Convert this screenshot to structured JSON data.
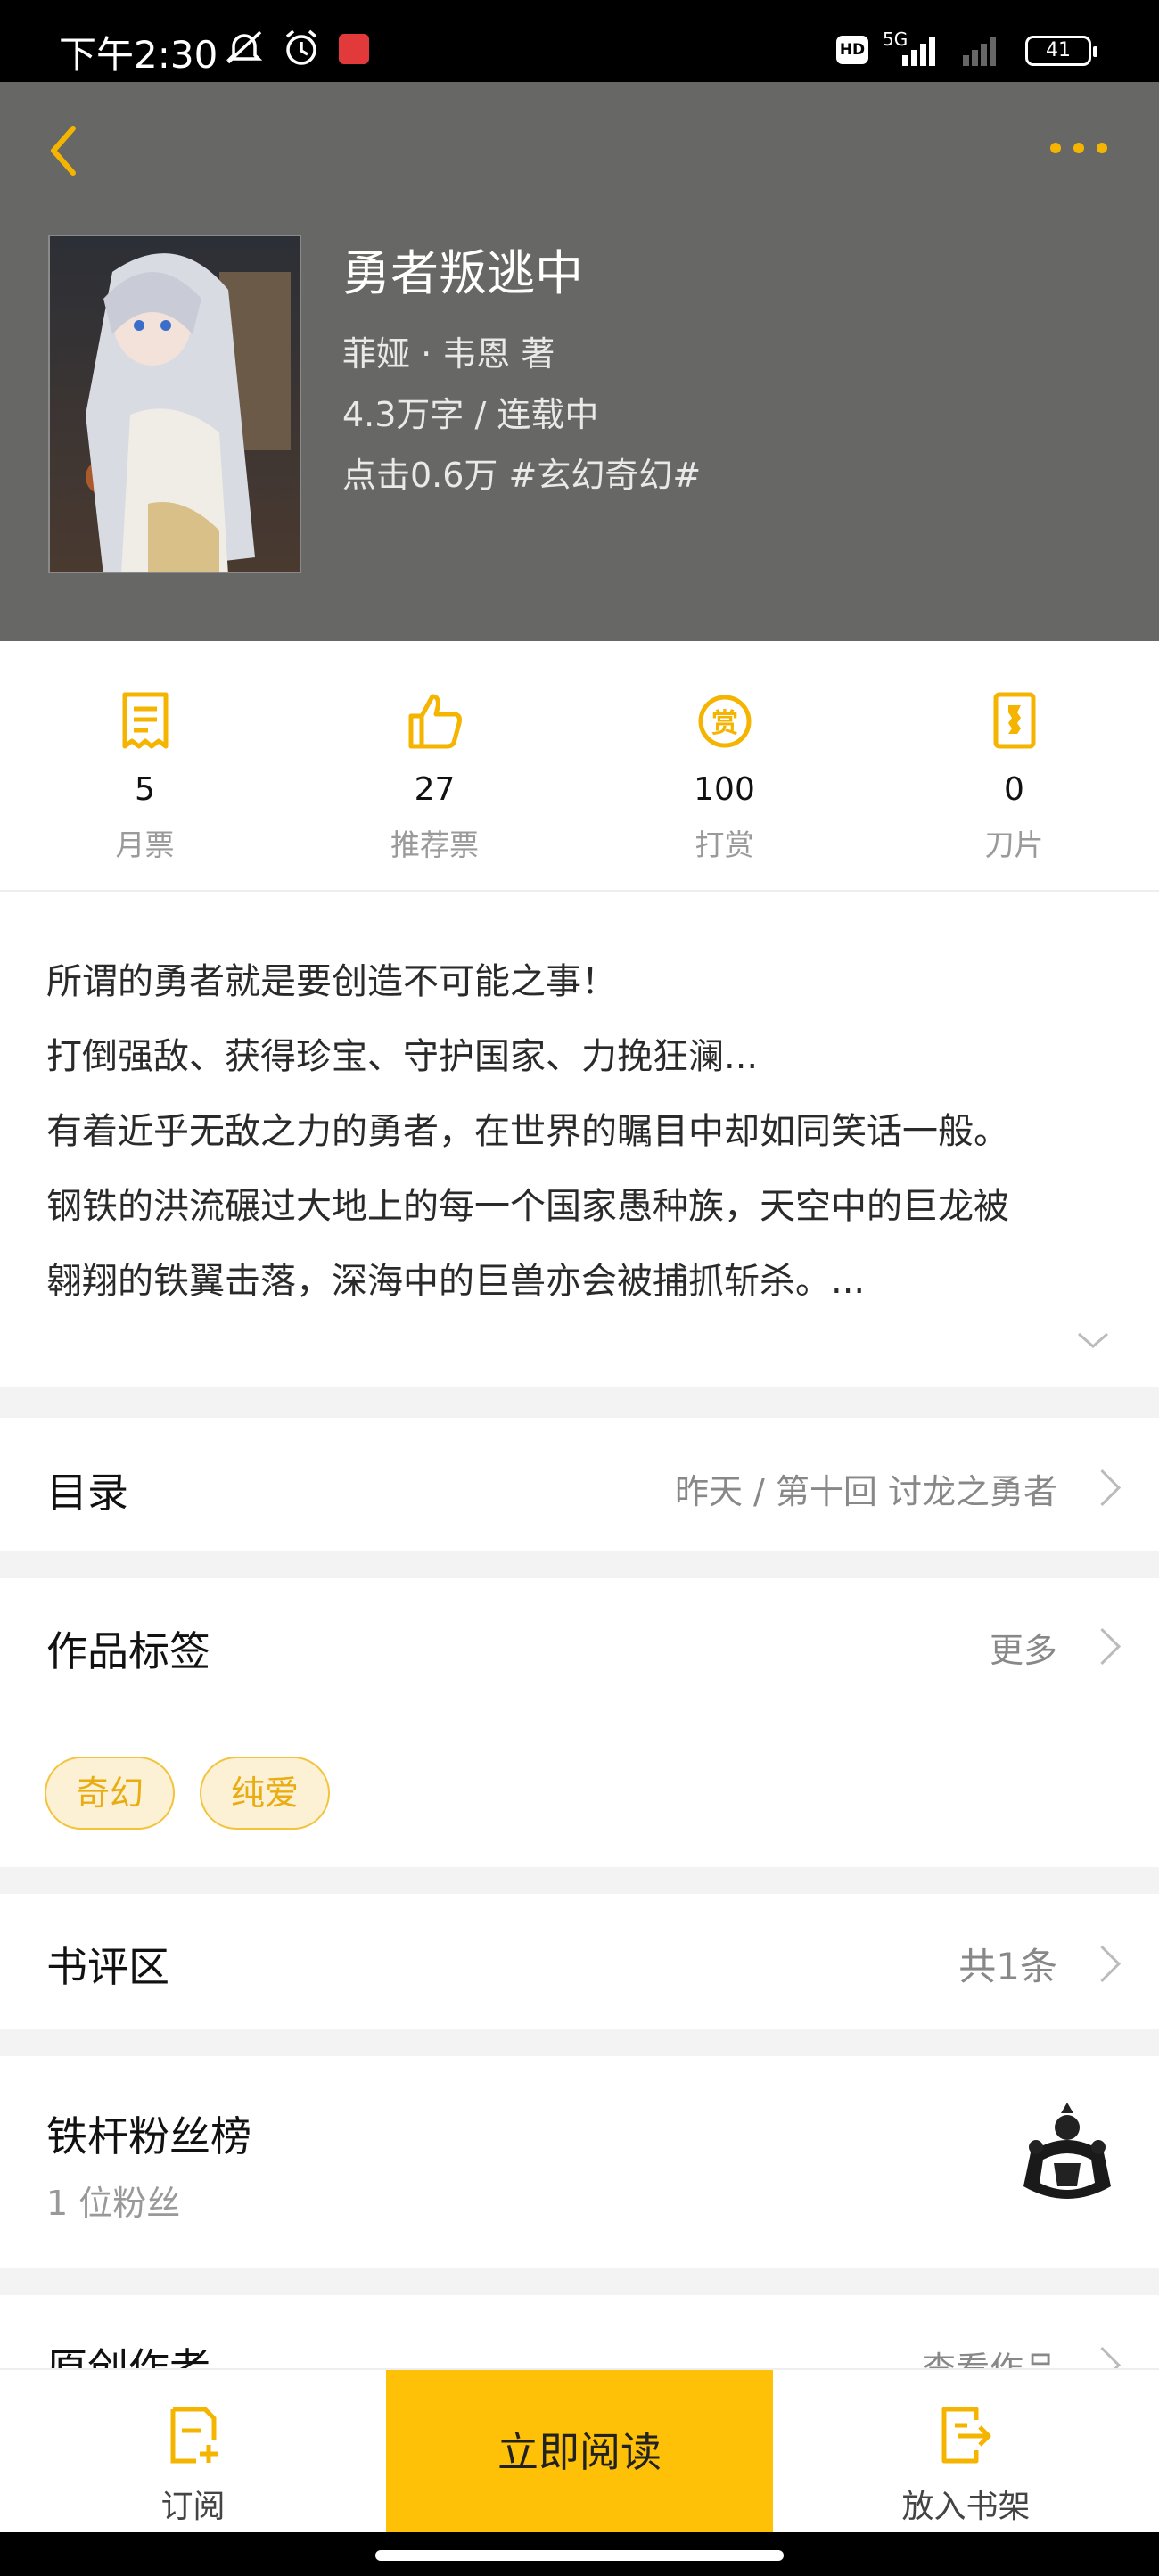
{
  "status_bar": {
    "time": "下午2:30",
    "network": "5G",
    "battery": "41"
  },
  "book": {
    "title": "勇者叛逃中",
    "author_line": "菲娅 · 韦恩  著",
    "words_status": "4.3万字 / 连载中",
    "clicks_genre": "点击0.6万  #玄幻奇幻#"
  },
  "stats": [
    {
      "value": "5",
      "label": "月票",
      "icon": "monthly-ticket-icon"
    },
    {
      "value": "27",
      "label": "推荐票",
      "icon": "thumbs-up-icon"
    },
    {
      "value": "100",
      "label": "打赏",
      "icon": "reward-icon"
    },
    {
      "value": "0",
      "label": "刀片",
      "icon": "blade-icon"
    }
  ],
  "intro": {
    "lines": [
      "所谓的勇者就是要创造不可能之事！",
      "打倒强敌、获得珍宝、守护国家、力挽狂澜...",
      "有着近乎无敌之力的勇者，在世界的瞩目中却如同笑话一般。",
      "钢铁的洪流碾过大地上的每一个国家愚种族，天空中的巨龙被",
      "翱翔的铁翼击落，深海中的巨兽亦会被捕抓斩杀。..."
    ]
  },
  "catalog": {
    "title": "目录",
    "latest": "昨天 / 第十回 讨龙之勇者"
  },
  "tags": {
    "title": "作品标签",
    "more": "更多",
    "items": [
      "奇幻",
      "纯爱"
    ]
  },
  "reviews": {
    "title": "书评区",
    "count": "共1条"
  },
  "fans": {
    "title": "铁杆粉丝榜",
    "count": "1 位粉丝"
  },
  "original_author": {
    "title": "原创作者",
    "link": "查看作品"
  },
  "bottom_bar": {
    "subscribe": "订阅",
    "read_now": "立即阅读",
    "add_shelf": "放入书架"
  },
  "colors": {
    "accent": "#ffc107",
    "header_bg": "#676766",
    "tag_text": "#e9ad12"
  }
}
